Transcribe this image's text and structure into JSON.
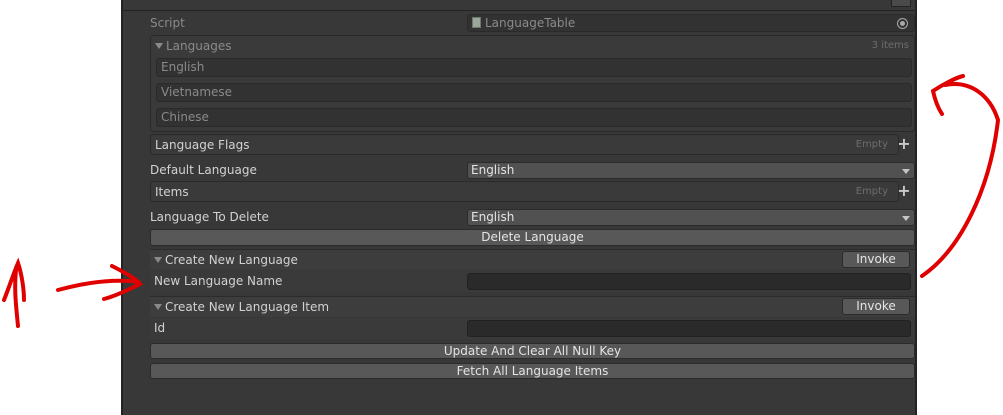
{
  "script": {
    "label": "Script",
    "value": "LanguageTable"
  },
  "languages": {
    "label": "Languages",
    "count": "3 items",
    "items": [
      "English",
      "Vietnamese",
      "Chinese"
    ]
  },
  "language_flags": {
    "label": "Language Flags",
    "empty": "Empty"
  },
  "default_language": {
    "label": "Default Language",
    "value": "English"
  },
  "items": {
    "label": "Items",
    "empty": "Empty"
  },
  "language_to_delete": {
    "label": "Language To Delete",
    "value": "English"
  },
  "delete_button": "Delete Language",
  "create_new_language": {
    "label": "Create New Language",
    "invoke": "Invoke",
    "param_label": "New Language Name",
    "param_value": ""
  },
  "create_new_language_item": {
    "label": "Create New Language Item",
    "invoke": "Invoke",
    "param_label": "Id",
    "param_value": ""
  },
  "update_button": "Update And Clear All Null Key",
  "fetch_button": "Fetch All Language Items",
  "colors": {
    "panel": "#383838",
    "annotation": "#e00000"
  }
}
